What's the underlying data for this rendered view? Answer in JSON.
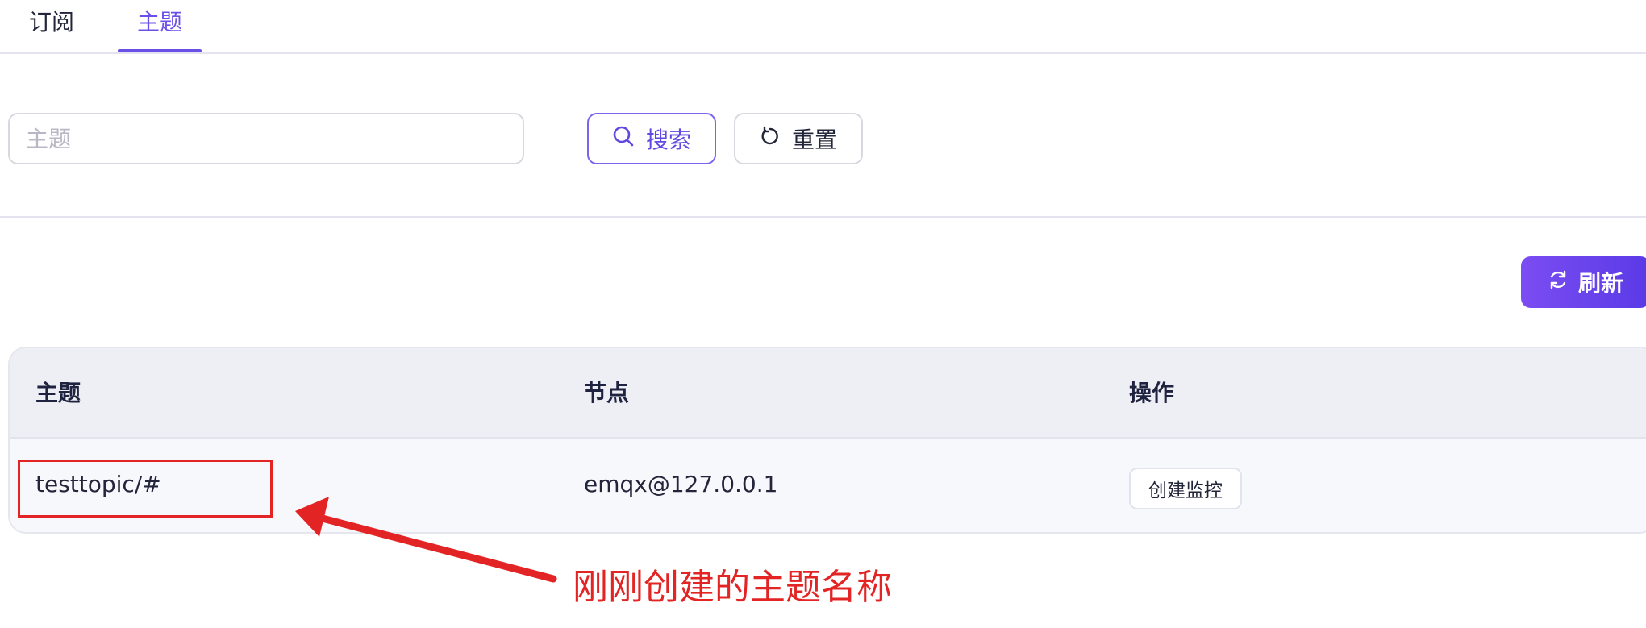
{
  "tabs": [
    {
      "label": "订阅",
      "active": false
    },
    {
      "label": "主题",
      "active": true
    }
  ],
  "search": {
    "placeholder": "主题",
    "value": "",
    "search_label": "搜索",
    "reset_label": "重置"
  },
  "toolbar": {
    "refresh_label": "刷新"
  },
  "table": {
    "columns": [
      "主题",
      "节点",
      "操作"
    ],
    "rows": [
      {
        "topic": "testtopic/#",
        "node": "emqx@127.0.0.1",
        "action_label": "创建监控"
      }
    ]
  },
  "annotation": {
    "text": "刚刚创建的主题名称",
    "color": "#e32424"
  },
  "colors": {
    "accent": "#6b50e8",
    "refresh_gradient_start": "#7b4df2",
    "refresh_gradient_end": "#5a3ae6",
    "annotation_red": "#e32424"
  },
  "icons": {
    "search": "search-icon",
    "reset": "reset-icon",
    "refresh": "refresh-icon"
  }
}
